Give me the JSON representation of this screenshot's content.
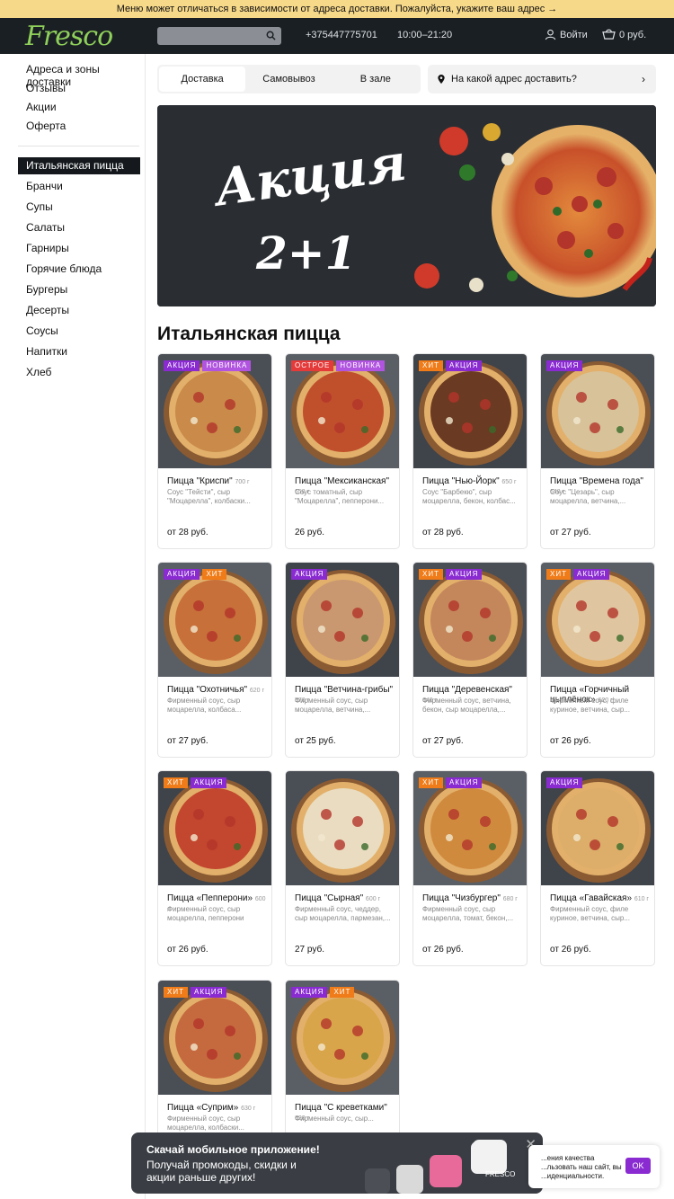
{
  "top_banner": "Меню может отличаться в зависимости от адреса доставки. Пожалуйста, укажите ваш адрес →",
  "header": {
    "logo": "Fresco",
    "phone": "+375447775701",
    "hours": "10:00–21:20",
    "login": "Войти",
    "cart": "0 руб."
  },
  "sidebar": {
    "info": [
      "Адреса и зоны доставки",
      "Отзывы",
      "Акции",
      "Оферта"
    ],
    "categories": [
      "Итальянская пицца",
      "Бранчи",
      "Супы",
      "Салаты",
      "Гарниры",
      "Горячие блюда",
      "Бургеры",
      "Десерты",
      "Соусы",
      "Напитки",
      "Хлеб"
    ]
  },
  "tabs": [
    "Доставка",
    "Самовывоз",
    "В зале"
  ],
  "address_button": "На какой адрес доставить?",
  "promo": {
    "line1": "Акция",
    "line2": "2+1"
  },
  "section_title": "Итальянская пицца",
  "products": [
    {
      "badges": [
        "АКЦИЯ",
        "НОВИНКА"
      ],
      "badge_types": [
        "akc",
        "new"
      ],
      "name": "Пицца \"Криспи\"",
      "weight": "700 г",
      "desc": "Соус \"Тейсти\", сыр \"Моцарелла\", колбаски...",
      "price": "от 28 руб.",
      "sauce": "#c98a4a"
    },
    {
      "badges": [
        "ОСТРОЕ",
        "НОВИНКА"
      ],
      "badge_types": [
        "hot",
        "new"
      ],
      "name": "Пицца \"Мексиканская\"",
      "weight": "650 г",
      "desc": "Соус томатный, сыр \"Моцарелла\", пепперони...",
      "price": "26 руб.",
      "sauce": "#c0502c"
    },
    {
      "badges": [
        "ХИТ",
        "АКЦИЯ"
      ],
      "badge_types": [
        "hit",
        "akc"
      ],
      "name": "Пицца \"Нью-Йорк\"",
      "weight": "650 г",
      "desc": "Соус \"Барбекю\", сыр моцарелла, бекон, колбас...",
      "price": "от 28 руб.",
      "sauce": "#6a3a22"
    },
    {
      "badges": [
        "АКЦИЯ"
      ],
      "badge_types": [
        "akc"
      ],
      "name": "Пицца \"Времена года\"",
      "weight": "640 г",
      "desc": "Соус \"Цезарь\", сыр моцарелла, ветчина,...",
      "price": "от 27 руб.",
      "sauce": "#d7c29a"
    },
    {
      "badges": [
        "АКЦИЯ",
        "ХИТ"
      ],
      "badge_types": [
        "akc",
        "hit"
      ],
      "name": "Пицца \"Охотничья\"",
      "weight": "620 г",
      "desc": "Фирменный соус, сыр моцарелла, колбаса...",
      "price": "от 27 руб.",
      "sauce": "#c7703a"
    },
    {
      "badges": [
        "АКЦИЯ"
      ],
      "badge_types": [
        "akc"
      ],
      "name": "Пицца \"Ветчина-грибы\"",
      "weight": "570 г",
      "desc": "Фирменный соус, сыр моцарелла, ветчина,...",
      "price": "от 25 руб.",
      "sauce": "#c99870"
    },
    {
      "badges": [
        "ХИТ",
        "АКЦИЯ"
      ],
      "badge_types": [
        "hit",
        "akc"
      ],
      "name": "Пицца \"Деревенская\"",
      "weight": "640 г",
      "desc": "Фирменный соус, ветчина, бекон, сыр моцарелла,...",
      "price": "от 27 руб.",
      "sauce": "#c4875c"
    },
    {
      "badges": [
        "ХИТ",
        "АКЦИЯ"
      ],
      "badge_types": [
        "hit",
        "akc"
      ],
      "name": "Пицца «Горчичный цыплёнок»",
      "weight": "620 г",
      "desc": "Фирменный соус, филе куриное, ветчина, сыр...",
      "price": "от 26 руб.",
      "sauce": "#e0c6a0"
    },
    {
      "badges": [
        "ХИТ",
        "АКЦИЯ"
      ],
      "badge_types": [
        "hit",
        "akc"
      ],
      "name": "Пицца «Пепперони»",
      "weight": "600 г",
      "desc": "Фирменный соус, сыр моцарелла, пепперони",
      "price": "от 26 руб.",
      "sauce": "#c2472e"
    },
    {
      "badges": [],
      "badge_types": [],
      "name": "Пицца \"Сырная\"",
      "weight": "600 г",
      "desc": "Фирменный соус, чеддер, сыр моцарелла, пармезан,...",
      "price": "27 руб.",
      "sauce": "#e9dcc0"
    },
    {
      "badges": [
        "ХИТ",
        "АКЦИЯ"
      ],
      "badge_types": [
        "hit",
        "akc"
      ],
      "name": "Пицца \"Чизбургер\"",
      "weight": "680 г",
      "desc": "Фирменный соус, сыр моцарелла, томат, бекон,...",
      "price": "от 26 руб.",
      "sauce": "#d08a3e"
    },
    {
      "badges": [
        "АКЦИЯ"
      ],
      "badge_types": [
        "akc"
      ],
      "name": "Пицца «Гавайская»",
      "weight": "610 г",
      "desc": "Фирменный соус, филе куриное, ветчина, сыр...",
      "price": "от 26 руб.",
      "sauce": "#dcae6a"
    },
    {
      "badges": [
        "ХИТ",
        "АКЦИЯ"
      ],
      "badge_types": [
        "hit",
        "akc"
      ],
      "name": "Пицца «Суприм»",
      "weight": "630 г",
      "desc": "Фирменный соус, сыр моцарелла, колбаски...",
      "price": "",
      "sauce": "#c56a3e"
    },
    {
      "badges": [
        "АКЦИЯ",
        "ХИТ"
      ],
      "badge_types": [
        "akc",
        "hit"
      ],
      "name": "Пицца \"С креветками\"",
      "weight": "620 г",
      "desc": "Фирменный соус, сыр...",
      "price": "",
      "sauce": "#d9a54a"
    }
  ],
  "app_popup": {
    "title": "Скачай мобильное приложение!",
    "text": "Получай промокоды, скидки и акции раньше других!",
    "logo": "FRESCO"
  },
  "cookie": {
    "text": "...ения качества ...льзовать наш сайт, вы ...иденциальности.",
    "ok": "OK"
  }
}
